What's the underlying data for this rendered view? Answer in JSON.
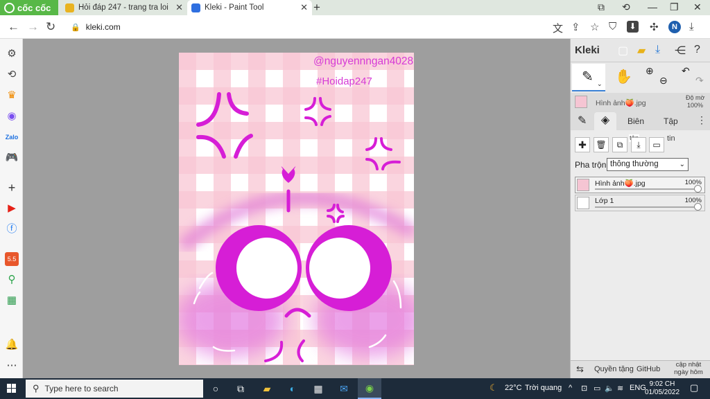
{
  "browser": {
    "brand": "cốc cốc",
    "tabs": [
      {
        "title": "Hỏi đáp 247 - trang tra loi",
        "active": false
      },
      {
        "title": "Kleki - Paint Tool",
        "active": true
      }
    ],
    "url": "kleki.com",
    "profile_initial": "N"
  },
  "artwork": {
    "watermark_handle": "@nguyennngan4028",
    "watermark_tag": "#Hoidap247",
    "colors": {
      "magenta": "#d61ed6",
      "pink_light": "#f8c6d4",
      "bg_white": "#ffffff"
    }
  },
  "kleki": {
    "logo": "Kleki",
    "layer_source_name": "Hình ảnh🍑.jpg",
    "opacity_label": "Độ mờ",
    "opacity_value": "100%",
    "panel_tabs": [
      "Biên",
      "Tập"
    ],
    "tap_tin": {
      "tap": "tập",
      "tin": "tin"
    },
    "blend_label": "Pha trộn",
    "blend_value": "thông thường",
    "layers": [
      {
        "name": "Hình ảnh🍑.jpg",
        "opacity": "100%",
        "selected": true
      },
      {
        "name": "Lớp 1",
        "opacity": "100%",
        "selected": false
      }
    ],
    "footer": {
      "license": "Quyền tặng",
      "github": "GitHub",
      "update_line1": "cập nhật",
      "update_line2": "ngày hôm qua"
    }
  },
  "taskbar": {
    "search_placeholder": "Type here to search",
    "weather": "22°C",
    "weather_text": "Trời quang",
    "lang": "ENG",
    "time": "9:02 CH",
    "date": "01/05/2022"
  }
}
